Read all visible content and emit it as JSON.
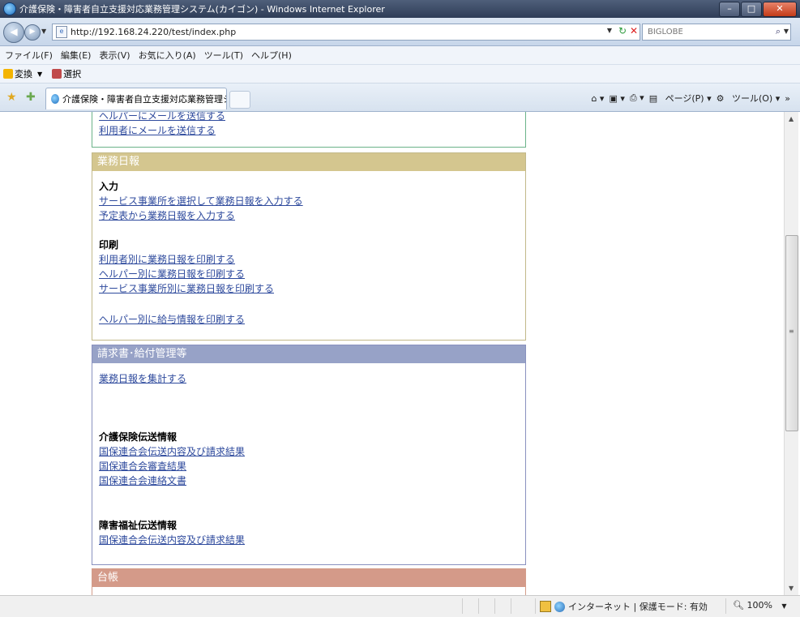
{
  "window": {
    "title": "介護保険・障害者自立支援対応業務管理システム(カイゴン) - Windows Internet Explorer"
  },
  "addressbar": {
    "url": "http://192.168.24.220/test/index.php",
    "search_placeholder": "BIGLOBE"
  },
  "menu": [
    "ファイル(F)",
    "編集(E)",
    "表示(V)",
    "お気に入り(A)",
    "ツール(T)",
    "ヘルプ(H)"
  ],
  "links": {
    "convert": "変換",
    "select": "選択"
  },
  "tab": {
    "label": "介護保険・障害者自立支援対応業務管理システ..."
  },
  "command": {
    "page": "ページ(P)",
    "tools": "ツール(O)"
  },
  "sections": {
    "top": {
      "link1": "ヘルパーにメールを送信する",
      "link2": "利用者にメールを送信する"
    },
    "daily": {
      "header": "業務日報",
      "input_title": "入力",
      "input_links": [
        "サービス事業所を選択して業務日報を入力する",
        "予定表から業務日報を入力する"
      ],
      "print_title": "印刷",
      "print_links": [
        "利用者別に業務日報を印刷する",
        "ヘルパー別に業務日報を印刷する",
        "サービス事業所別に業務日報を印刷する"
      ],
      "salary_link": "ヘルパー別に給与情報を印刷する"
    },
    "billing": {
      "header": "請求書･給付管理等",
      "aggregate_link": "業務日報を集計する",
      "kaigo_title": "介護保険伝送情報",
      "kaigo_links": [
        "国保連合会伝送内容及び請求結果",
        "国保連合会審査結果",
        "国保連合会連絡文書"
      ],
      "shogai_title": "障害福祉伝送情報",
      "shogai_links": [
        "国保連合会伝送内容及び請求結果"
      ]
    },
    "ledger": {
      "header": "台帳"
    }
  },
  "status": {
    "zone": "インターネット | 保護モード: 有効",
    "zoom": "100%"
  }
}
